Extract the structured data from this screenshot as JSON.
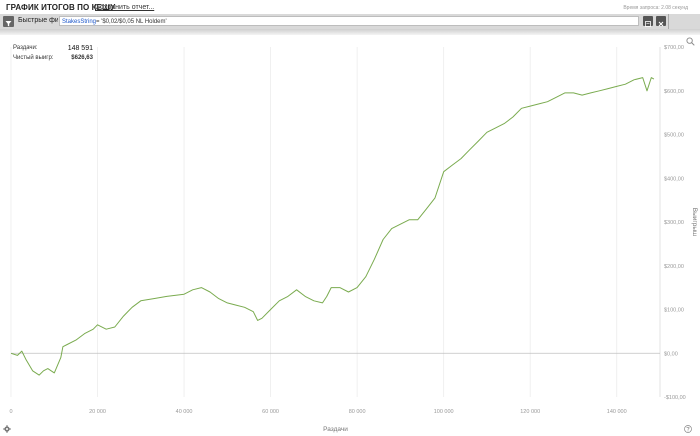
{
  "header": {
    "title": "ГРАФИК ИТОГОВ ПО КЕШУ",
    "save_report": "Сохранить отчет...",
    "request_time": "Время запроса: 2.08 секунд"
  },
  "filter": {
    "label": "Быстрые фильтры",
    "key": "StakesString",
    "rest": "= '$0,02/$0,05 NL Holdem'"
  },
  "stats": {
    "hands_label": "Раздачи:",
    "hands_value": "148 591",
    "net_label": "Чистый выигр:",
    "net_value": "$626,63"
  },
  "icons": {
    "filter": "filter-icon",
    "edit": "edit-icon",
    "clear": "close-icon",
    "zoom": "magnifier-icon",
    "settings": "gear-icon",
    "help": "help-icon"
  },
  "colors": {
    "line": "#7aab4f",
    "zero_line": "#c0c0c0",
    "grid": "#ececec",
    "filter_key": "#1a55c9"
  },
  "chart_data": {
    "type": "line",
    "title": "",
    "xlabel": "Раздачи",
    "ylabel": "Выигрыш",
    "xlim": [
      0,
      150000
    ],
    "ylim": [
      -100,
      700
    ],
    "x_ticks": [
      0,
      20000,
      40000,
      60000,
      80000,
      100000,
      120000,
      140000
    ],
    "x_tick_labels": [
      "0",
      "20 000",
      "40 000",
      "60 000",
      "80 000",
      "100 000",
      "120 000",
      "140 000"
    ],
    "y_ticks": [
      -100,
      0,
      100,
      200,
      300,
      400,
      500,
      600,
      700
    ],
    "y_tick_labels": [
      "-$100,00",
      "$0,00",
      "$100,00",
      "$200,00",
      "$300,00",
      "$400,00",
      "$500,00",
      "$600,00",
      "$700,00"
    ],
    "grid": "vertical",
    "series": [
      {
        "x": [
          0,
          1500,
          2500,
          3500,
          5000,
          6500,
          7500,
          8500,
          10000,
          11500,
          12000,
          13000,
          15000,
          17000,
          19000,
          20000,
          22000,
          24000,
          26000,
          28000,
          30000,
          33000,
          36000,
          40000,
          42000,
          44000,
          46000,
          48000,
          50000,
          52000,
          54000,
          56000,
          57000,
          58000,
          60000,
          62000,
          64000,
          66000,
          68000,
          70000,
          72000,
          73000,
          74000,
          76000,
          78000,
          80000,
          82000,
          84000,
          86000,
          88000,
          90000,
          92000,
          94000,
          96000,
          98000,
          100000,
          102000,
          104000,
          106000,
          108000,
          110000,
          112000,
          114000,
          116000,
          118000,
          120000,
          122000,
          124000,
          126000,
          128000,
          130000,
          132000,
          134000,
          136000,
          138000,
          140000,
          142000,
          144000,
          146000,
          147000,
          148000,
          148591
        ],
        "y": [
          0,
          -5,
          5,
          -15,
          -40,
          -50,
          -40,
          -35,
          -45,
          -10,
          15,
          20,
          30,
          45,
          55,
          65,
          55,
          60,
          85,
          105,
          120,
          125,
          130,
          135,
          145,
          150,
          140,
          125,
          115,
          110,
          105,
          95,
          75,
          80,
          100,
          120,
          130,
          145,
          130,
          120,
          115,
          130,
          150,
          150,
          140,
          150,
          175,
          215,
          260,
          285,
          295,
          305,
          305,
          330,
          355,
          415,
          430,
          445,
          465,
          485,
          505,
          515,
          525,
          540,
          560,
          565,
          570,
          575,
          585,
          595,
          595,
          590,
          595,
          600,
          605,
          610,
          615,
          625,
          630,
          600,
          630,
          626.63
        ]
      }
    ]
  }
}
